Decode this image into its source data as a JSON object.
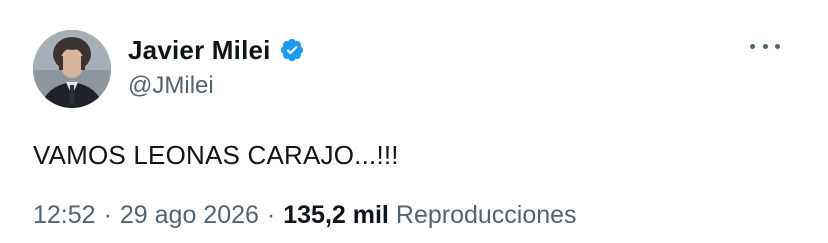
{
  "author": {
    "display_name": "Javier Milei",
    "handle": "@JMilei",
    "verified": true,
    "verified_color": "#1d9bf0"
  },
  "tweet": {
    "text": "VAMOS LEONAS CARAJO...!!!",
    "time": "12:52",
    "date": "29 ago 2026",
    "separator": "·",
    "views_count": "135,2 mil",
    "views_label": "Reproducciones"
  },
  "icons": {
    "more": "more-horizontal-icon",
    "verified": "verified-badge-icon"
  },
  "colors": {
    "text_primary": "#0f1419",
    "text_secondary": "#536471",
    "background": "#ffffff"
  }
}
